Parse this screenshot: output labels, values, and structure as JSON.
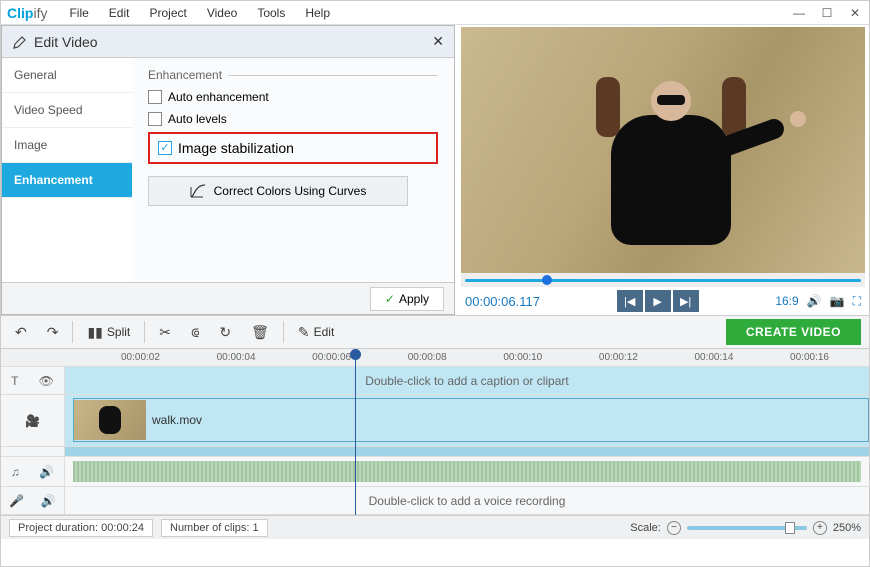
{
  "app": {
    "logo_a": "Clip",
    "logo_b": "ify"
  },
  "menubar": {
    "items": [
      "File",
      "Edit",
      "Project",
      "Video",
      "Tools",
      "Help"
    ]
  },
  "edit_panel": {
    "title": "Edit Video",
    "tabs": [
      "General",
      "Video Speed",
      "Image",
      "Enhancement"
    ],
    "active_tab": 3,
    "section_label": "Enhancement",
    "opts": {
      "auto_enhance": {
        "label": "Auto enhancement",
        "checked": false
      },
      "auto_levels": {
        "label": "Auto levels",
        "checked": false
      },
      "stabilization": {
        "label": "Image stabilization",
        "checked": true
      }
    },
    "curves_btn": "Correct Colors Using Curves",
    "apply_btn": "Apply"
  },
  "preview": {
    "time": "00:00:06.117",
    "ratio": "16:9"
  },
  "toolbar": {
    "split": "Split",
    "edit": "Edit",
    "create": "CREATE VIDEO"
  },
  "ruler": [
    "00:00:02",
    "00:00:04",
    "00:00:06",
    "00:00:08",
    "00:00:10",
    "00:00:12",
    "00:00:14",
    "00:00:16"
  ],
  "timeline": {
    "caption_hint": "Double-click to add a caption or clipart",
    "clip_name": "walk.mov",
    "voice_hint": "Double-click to add a voice recording"
  },
  "status": {
    "duration_label": "Project duration:",
    "duration": "00:00:24",
    "clips_label": "Number of clips:",
    "clips": "1",
    "scale_label": "Scale:",
    "scale": "250%"
  }
}
